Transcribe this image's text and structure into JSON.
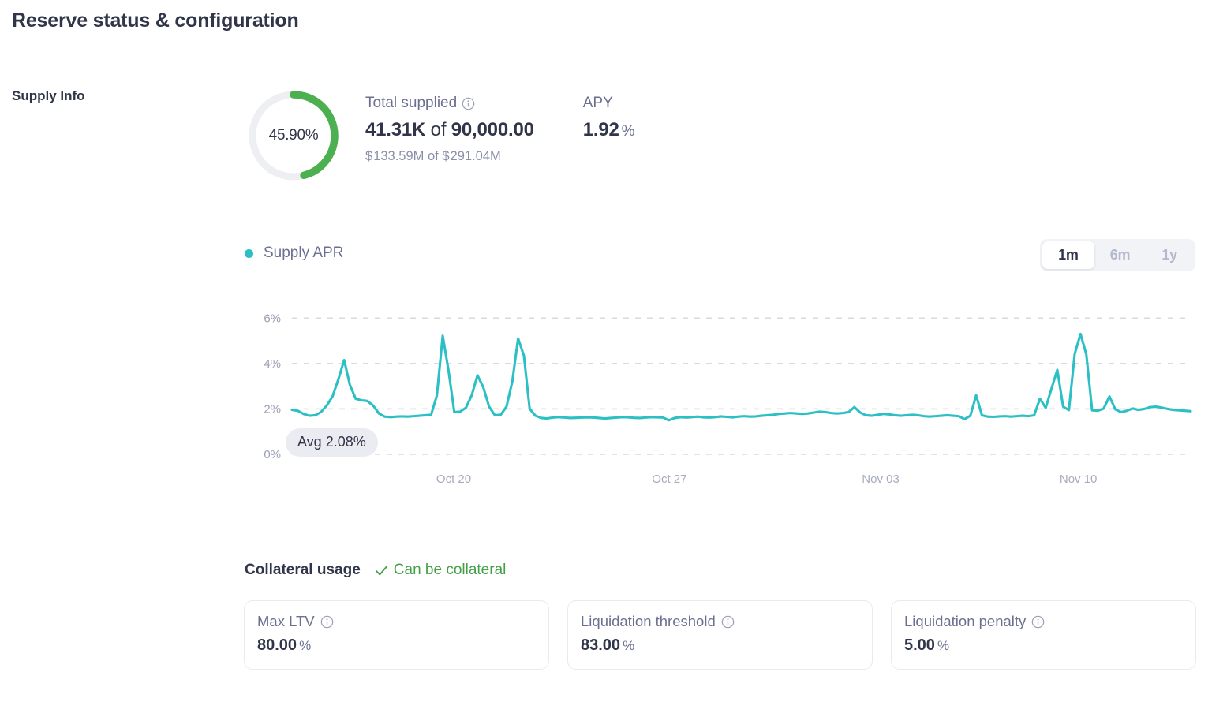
{
  "page": {
    "title": "Reserve status & configuration"
  },
  "supply_info": {
    "section_label": "Supply Info",
    "donut": {
      "percent_label": "45.90%",
      "percent_value": 45.9,
      "fill_color": "#4caf50",
      "track_color": "#eeeff3"
    },
    "total_supplied": {
      "label": "Total supplied",
      "info_icon": "info-circle-icon",
      "amount": "41.31K",
      "conjunction": "of",
      "cap": "90,000.00",
      "usd_amount": "133.59M",
      "usd_cap": "291.04M",
      "currency_symbol": "$",
      "usd_conjunction": "of"
    },
    "apy": {
      "label": "APY",
      "value": "1.92",
      "unit": "%"
    }
  },
  "chart": {
    "legend": {
      "label": "Supply APR",
      "dot_color": "#2cbfc4"
    },
    "range_options": [
      {
        "label": "1m",
        "active": true
      },
      {
        "label": "6m",
        "active": false
      },
      {
        "label": "1y",
        "active": false
      }
    ],
    "avg_badge": "Avg 2.08%"
  },
  "chart_data": {
    "type": "line",
    "title": "Supply APR",
    "xlabel": "",
    "ylabel": "",
    "ylim": [
      0,
      6.6
    ],
    "yticks": [
      0,
      2,
      4,
      6
    ],
    "ytick_labels": [
      "0%",
      "2%",
      "4%",
      "6%"
    ],
    "xtick_labels": [
      "Oct 20",
      "Oct 27",
      "Nov 03",
      "Nov 10"
    ],
    "xtick_positions": [
      0.18,
      0.42,
      0.655,
      0.875
    ],
    "grid": true,
    "legend_position": "top-left",
    "line_color": "#2cbfc4",
    "annotations": [
      {
        "text": "Avg 2.08%",
        "value": 2.08,
        "type": "average-badge"
      }
    ],
    "series": [
      {
        "name": "Supply APR",
        "values": [
          1.96,
          1.92,
          1.78,
          1.7,
          1.72,
          1.86,
          2.15,
          2.55,
          3.3,
          4.15,
          3.05,
          2.45,
          2.38,
          2.35,
          2.15,
          1.8,
          1.66,
          1.64,
          1.66,
          1.67,
          1.66,
          1.68,
          1.7,
          1.72,
          1.74,
          2.6,
          5.22,
          3.7,
          1.86,
          1.88,
          2.05,
          2.6,
          3.48,
          2.95,
          2.1,
          1.72,
          1.74,
          2.1,
          3.2,
          5.1,
          4.35,
          2.0,
          1.7,
          1.6,
          1.58,
          1.62,
          1.64,
          1.62,
          1.6,
          1.61,
          1.62,
          1.63,
          1.62,
          1.6,
          1.58,
          1.6,
          1.62,
          1.64,
          1.63,
          1.61,
          1.6,
          1.62,
          1.64,
          1.63,
          1.62,
          1.5,
          1.6,
          1.64,
          1.62,
          1.64,
          1.66,
          1.63,
          1.62,
          1.64,
          1.67,
          1.65,
          1.63,
          1.66,
          1.68,
          1.66,
          1.67,
          1.7,
          1.72,
          1.74,
          1.78,
          1.8,
          1.82,
          1.8,
          1.78,
          1.8,
          1.84,
          1.88,
          1.86,
          1.82,
          1.8,
          1.82,
          1.86,
          2.08,
          1.84,
          1.72,
          1.7,
          1.74,
          1.78,
          1.76,
          1.72,
          1.7,
          1.72,
          1.74,
          1.72,
          1.68,
          1.66,
          1.68,
          1.7,
          1.72,
          1.7,
          1.68,
          1.55,
          1.7,
          2.6,
          1.72,
          1.66,
          1.65,
          1.67,
          1.68,
          1.66,
          1.68,
          1.7,
          1.68,
          1.72,
          2.45,
          2.05,
          2.9,
          3.72,
          2.1,
          1.95,
          4.42,
          5.3,
          4.4,
          1.94,
          1.92,
          2.02,
          2.55,
          1.98,
          1.86,
          1.92,
          2.02,
          1.96,
          2.0,
          2.08,
          2.1,
          2.06,
          2.0,
          1.96,
          1.94,
          1.92,
          1.9
        ]
      }
    ]
  },
  "collateral": {
    "title": "Collateral usage",
    "status_text": "Can be collateral",
    "status_icon": "check-icon",
    "status_color": "#43a047",
    "cards": [
      {
        "label": "Max LTV",
        "info_icon": "info-circle-icon",
        "value": "80.00",
        "unit": "%"
      },
      {
        "label": "Liquidation threshold",
        "info_icon": "info-circle-icon",
        "value": "83.00",
        "unit": "%"
      },
      {
        "label": "Liquidation penalty",
        "info_icon": "info-circle-icon",
        "value": "5.00",
        "unit": "%"
      }
    ]
  }
}
